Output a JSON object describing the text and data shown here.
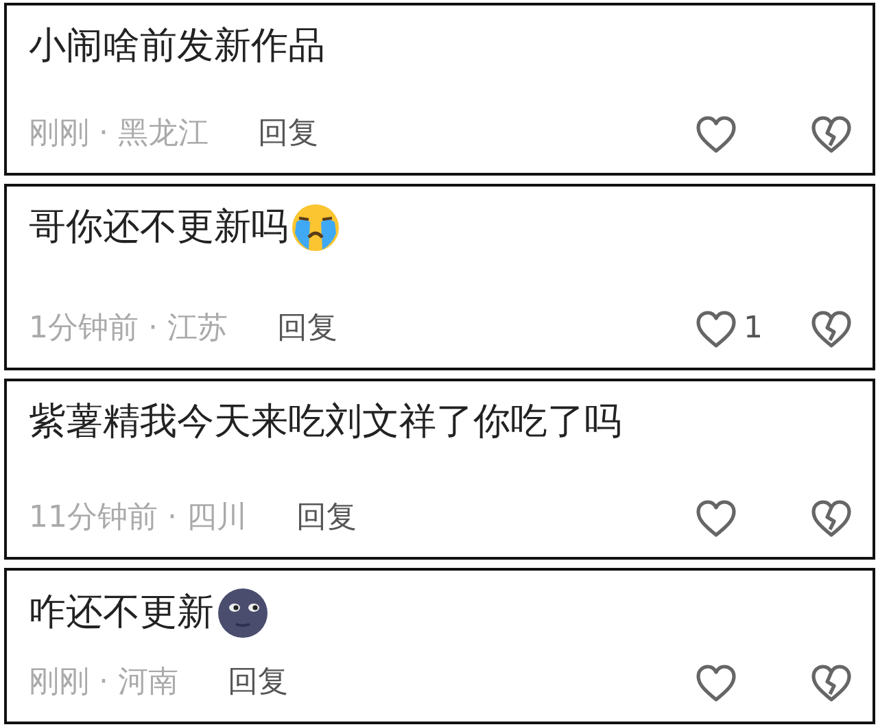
{
  "comments": [
    {
      "text": "小闹啥前发新作品",
      "meta": "刚刚 · 黑龙江",
      "reply": "回复"
    },
    {
      "text": "哥你还不更新吗",
      "emoji": {
        "kind": "crying"
      },
      "meta": "1分钟前 · 江苏",
      "reply": "回复",
      "like_count": "1"
    },
    {
      "text": "紫薯精我今天来吃刘文祥了你吃了吗",
      "meta": "11分钟前 · 四川",
      "reply": "回复"
    },
    {
      "text": "咋还不更新",
      "emoji": {
        "kind": "moon"
      },
      "meta": "刚刚 · 河南",
      "reply": "回复"
    }
  ]
}
